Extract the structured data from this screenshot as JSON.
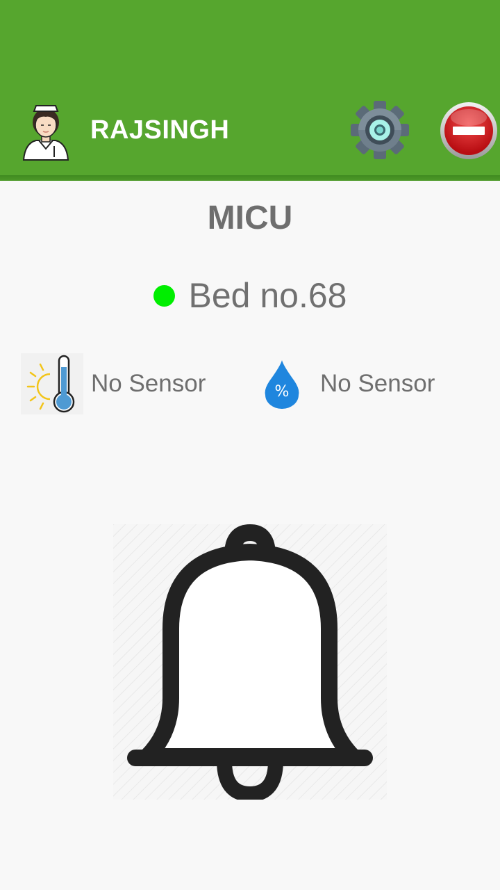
{
  "header": {
    "username": "RAJSINGH",
    "background_color": "#56a62e",
    "icons": {
      "avatar": "nurse-avatar-icon",
      "settings": "gear-icon",
      "logout": "stop-minus-icon"
    }
  },
  "main": {
    "ward": "MICU",
    "bed": {
      "label": "Bed no.68",
      "status_color": "#00ee00"
    },
    "sensors": [
      {
        "icon": "thermometer-icon",
        "value": "No Sensor"
      },
      {
        "icon": "humidity-drop-icon",
        "value": "No Sensor"
      }
    ],
    "alarm": {
      "icon": "bell-icon"
    }
  }
}
